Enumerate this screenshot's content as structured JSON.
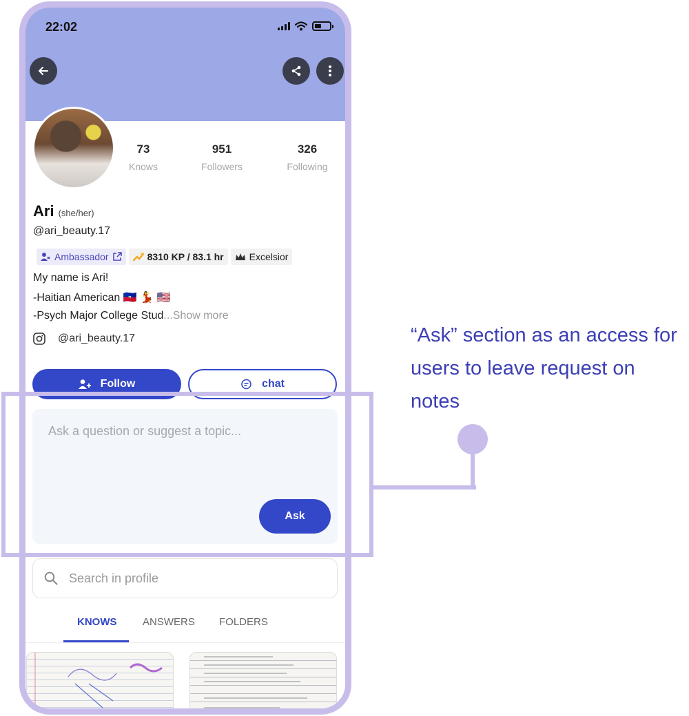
{
  "status_bar": {
    "time": "22:02"
  },
  "header": {
    "back_icon": "arrow-left-icon",
    "share_icon": "share-icon",
    "more_icon": "more-vertical-icon"
  },
  "profile": {
    "name": "Ari",
    "pronouns": "(she/her)",
    "handle": "@ari_beauty.17",
    "stats": [
      {
        "value": "73",
        "label": "Knows"
      },
      {
        "value": "951",
        "label": "Followers"
      },
      {
        "value": "326",
        "label": "Following"
      }
    ],
    "badges": {
      "ambassador": "Ambassador",
      "kp": "8310 KP / 83.1 hr",
      "rank": "Excelsior"
    },
    "bio": {
      "line1": "My name is Ari!",
      "line2": "-Haitian American 🇭🇹 💃 🇺🇸",
      "line3": "-Psych Major College Stud",
      "show_more": "...Show more"
    },
    "instagram_handle": "@ari_beauty.17"
  },
  "actions": {
    "follow_label": "Follow",
    "chat_label": "chat"
  },
  "ask": {
    "placeholder": "Ask a question or suggest a topic...",
    "button_label": "Ask"
  },
  "search": {
    "placeholder": "Search in profile"
  },
  "tabs": [
    {
      "label": "KNOWS",
      "active": true
    },
    {
      "label": "ANSWERS",
      "active": false
    },
    {
      "label": "FOLDERS",
      "active": false
    }
  ],
  "annotation": {
    "text": "“Ask” section as an access for users to leave request on notes"
  },
  "colors": {
    "accent": "#3347c9",
    "cover": "#9da8e6",
    "annotation": "#c8bdea",
    "annotation_text": "#3c3fb3"
  }
}
